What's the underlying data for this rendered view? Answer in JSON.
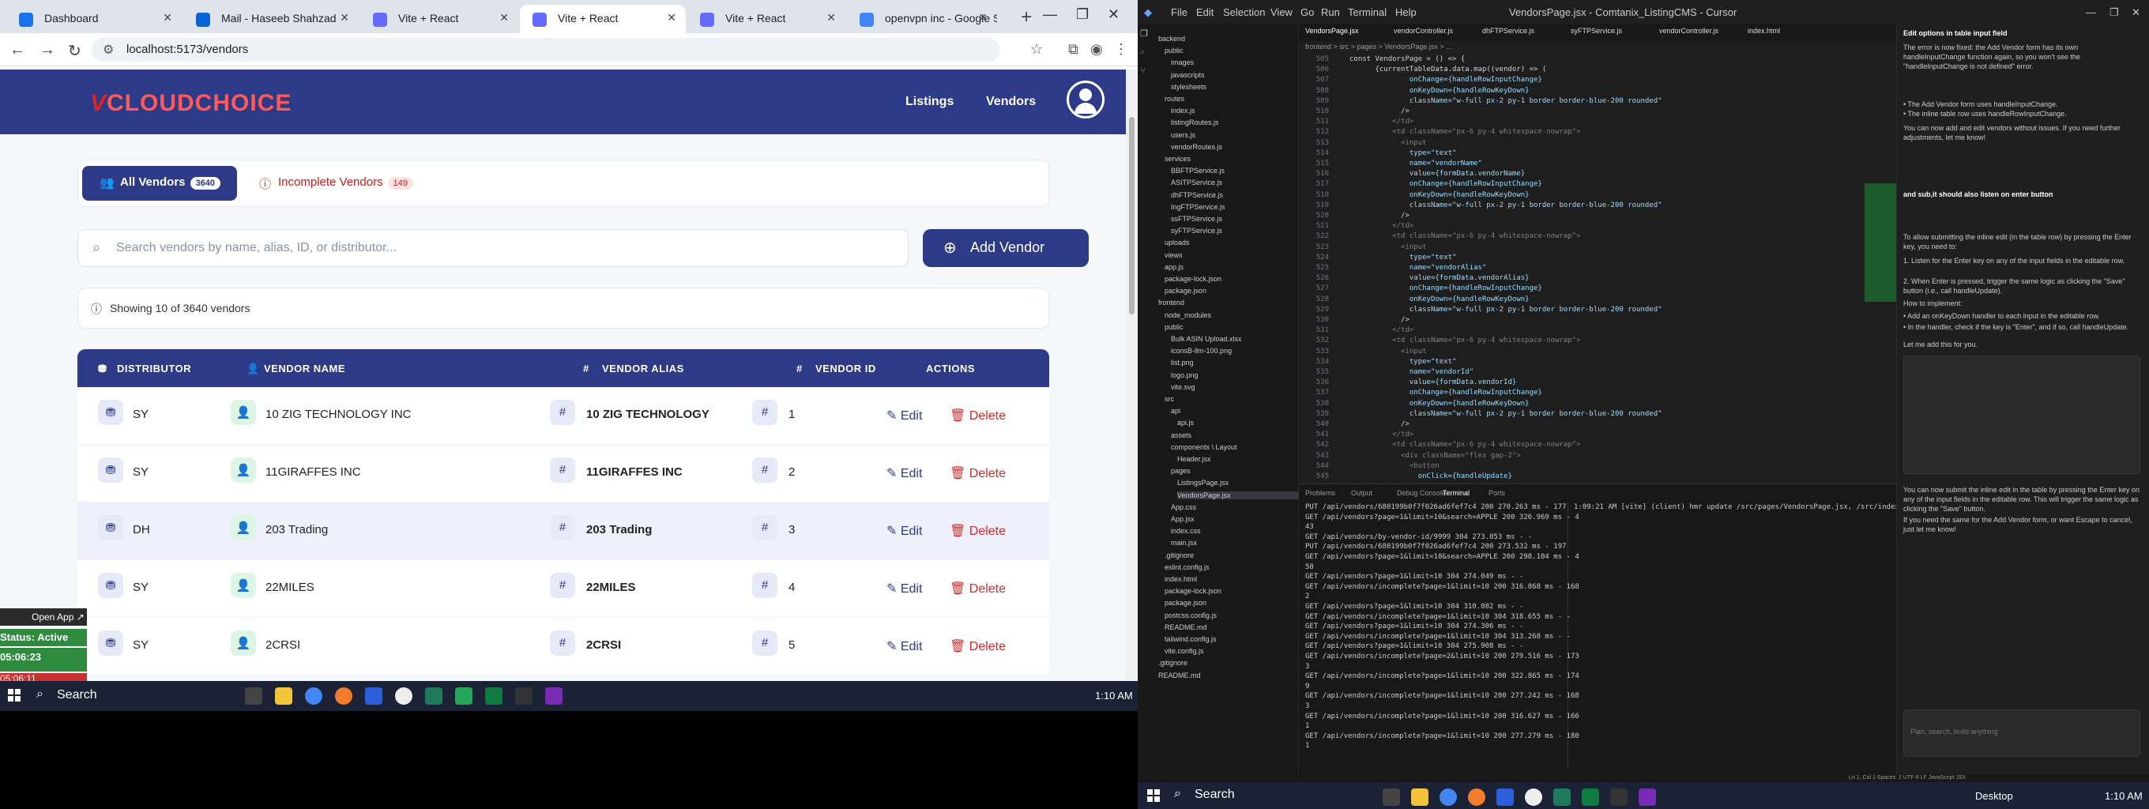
{
  "browser": {
    "tabs": [
      {
        "label": "Dashboard",
        "color": "#1a73e8"
      },
      {
        "label": "Mail - Haseeb Shahzad",
        "color": "#0a64d6"
      },
      {
        "label": "Vite + React",
        "color": "#646cff"
      },
      {
        "label": "Vite + React",
        "color": "#646cff"
      },
      {
        "label": "Vite + React",
        "color": "#646cff"
      },
      {
        "label": "openvpn inc - Google S",
        "color": "#4285f4"
      }
    ],
    "url": "localhost:5173/vendors"
  },
  "app": {
    "logo_v": "V",
    "logo_text": "CLOUDCHOICE",
    "nav": [
      "Listings",
      "Vendors"
    ],
    "filters": {
      "all_label": "All Vendors",
      "all_count": "3640",
      "incomplete_label": "Incomplete Vendors",
      "incomplete_count": "149"
    },
    "search_placeholder": "Search vendors by name, alias, ID, or distributor...",
    "add_vendor": "Add Vendor",
    "showing": "Showing 10 of 3640 vendors",
    "columns": [
      "DISTRIBUTOR",
      "VENDOR NAME",
      "VENDOR ALIAS",
      "VENDOR ID",
      "ACTIONS"
    ],
    "edit_label": "Edit",
    "delete_label": "Delete",
    "rows": [
      {
        "distributor": "SY",
        "name": "10 ZIG TECHNOLOGY INC",
        "alias": "10 ZIG TECHNOLOGY",
        "id": "1"
      },
      {
        "distributor": "SY",
        "name": "11GIRAFFES INC",
        "alias": "11GIRAFFES INC",
        "id": "2"
      },
      {
        "distributor": "DH",
        "name": "203 Trading",
        "alias": "203 Trading",
        "id": "3"
      },
      {
        "distributor": "SY",
        "name": "22MILES",
        "alias": "22MILES",
        "id": "4"
      },
      {
        "distributor": "SY",
        "name": "2CRSI",
        "alias": "2CRSI",
        "id": "5"
      }
    ]
  },
  "widget": {
    "open_app": "Open App ↗",
    "status": "Status: Active",
    "time": "05:06:23",
    "time2": "05:06:11"
  },
  "taskbar": {
    "search": "Search",
    "clock": "1:10 AM"
  },
  "vscode": {
    "menu": [
      "File",
      "Edit",
      "Selection",
      "View",
      "Go",
      "Run",
      "Terminal",
      "Help"
    ],
    "title": "VendorsPage.jsx - Comtanix_ListingCMS - Cursor",
    "explorer": [
      "backend",
      "public",
      "images",
      "javascripts",
      "stylesheets",
      "routes",
      "index.js",
      "listingRoutes.js",
      "users.js",
      "vendorRoutes.js",
      "services",
      "BBFTPService.js",
      "ASITPService.js",
      "dhFTPService.js",
      "IngFTPService.js",
      "ssFTPService.js",
      "syFTPService.js",
      "uploads",
      "views",
      "app.js",
      "package-lock.json",
      "package.json",
      "frontend",
      "node_modules",
      "public",
      "Bulk ASIN Upload.xlsx",
      "iconsB-llm-100.png",
      "list.png",
      "logo.png",
      "vite.svg",
      "src",
      "api",
      "api.js",
      "assets",
      "components \\ Layout",
      "Header.jsx",
      "pages",
      "ListingsPage.jsx",
      "VendorsPage.jsx",
      "App.css",
      "App.jsx",
      "index.css",
      "main.jsx",
      ".gitignore",
      "eslint.config.js",
      "index.html",
      "package-lock.json",
      "package.json",
      "postcss.config.js",
      "README.md",
      "tailwind.config.js",
      "vite.config.js",
      ".gitignore",
      "README.md"
    ],
    "editor_tabs": [
      "VendorsPage.jsx",
      "vendorController.js",
      "dhFTPService.js",
      "syFTPService.js",
      "vendorController.js",
      "index.html"
    ],
    "breadcrumb": "frontend > src > pages > VendorsPage.jsx > ...",
    "code_lines": [
      {
        "n": "505",
        "t": "const VendorsPage = () => {"
      },
      {
        "n": "506",
        "t": "      {currentTableData.data.map((vendor) => ("
      },
      {
        "n": "507",
        "t": "              onChange={handleRowInputChange}"
      },
      {
        "n": "508",
        "t": "              onKeyDown={handleRowKeyDown}"
      },
      {
        "n": "509",
        "t": "              className=\"w-full px-2 py-1 border border-blue-200 rounded\""
      },
      {
        "n": "510",
        "t": "            />"
      },
      {
        "n": "511",
        "t": "          </td>"
      },
      {
        "n": "512",
        "t": "          <td className=\"px-6 py-4 whitespace-nowrap\">"
      },
      {
        "n": "513",
        "t": "            <input"
      },
      {
        "n": "514",
        "t": "              type=\"text\""
      },
      {
        "n": "515",
        "t": "              name=\"vendorName\""
      },
      {
        "n": "516",
        "t": "              value={formData.vendorName}"
      },
      {
        "n": "517",
        "t": "              onChange={handleRowInputChange}"
      },
      {
        "n": "518",
        "t": "              onKeyDown={handleRowKeyDown}"
      },
      {
        "n": "519",
        "t": "              className=\"w-full px-2 py-1 border border-blue-200 rounded\""
      },
      {
        "n": "520",
        "t": "            />"
      },
      {
        "n": "521",
        "t": "          </td>"
      },
      {
        "n": "522",
        "t": "          <td className=\"px-6 py-4 whitespace-nowrap\">"
      },
      {
        "n": "523",
        "t": "            <input"
      },
      {
        "n": "524",
        "t": "              type=\"text\""
      },
      {
        "n": "525",
        "t": "              name=\"vendorAlias\""
      },
      {
        "n": "526",
        "t": "              value={formData.vendorAlias}"
      },
      {
        "n": "527",
        "t": "              onChange={handleRowInputChange}"
      },
      {
        "n": "528",
        "t": "              onKeyDown={handleRowKeyDown}"
      },
      {
        "n": "529",
        "t": "              className=\"w-full px-2 py-1 border border-blue-200 rounded\""
      },
      {
        "n": "530",
        "t": "            />"
      },
      {
        "n": "531",
        "t": "          </td>"
      },
      {
        "n": "532",
        "t": "          <td className=\"px-6 py-4 whitespace-nowrap\">"
      },
      {
        "n": "533",
        "t": "            <input"
      },
      {
        "n": "534",
        "t": "              type=\"text\""
      },
      {
        "n": "535",
        "t": "              name=\"vendorId\""
      },
      {
        "n": "536",
        "t": "              value={formData.vendorId}"
      },
      {
        "n": "537",
        "t": "              onChange={handleRowInputChange}"
      },
      {
        "n": "538",
        "t": "              onKeyDown={handleRowKeyDown}"
      },
      {
        "n": "539",
        "t": "              className=\"w-full px-2 py-1 border border-blue-200 rounded\""
      },
      {
        "n": "540",
        "t": "            />"
      },
      {
        "n": "541",
        "t": "          </td>"
      },
      {
        "n": "542",
        "t": "          <td className=\"px-6 py-4 whitespace-nowrap\">"
      },
      {
        "n": "543",
        "t": "            <div className=\"flex gap-2\">"
      },
      {
        "n": "544",
        "t": "              <button"
      },
      {
        "n": "545",
        "t": "                onClick={handleUpdate}"
      }
    ],
    "panel_tabs": [
      "Problems",
      "Output",
      "Debug Console",
      "Terminal",
      "Ports"
    ],
    "terminal_lines": [
      "PUT /api/vendors/680199b0f7f026ad6fef7c4 200 270.263 ms - 177",
      "GET /api/vendors?page=1&limit=10&search=APPLE 200 326.969 ms - 4",
      "43",
      "GET /api/vendors/by-vendor-id/9999 304 273.853 ms - -",
      "PUT /api/vendors/680199b0f7f026ad6fef7c4 200 273.532 ms - 197",
      "GET /api/vendors?page=1&limit=10&search=APPLE 200 298.104 ms - 4",
      "58",
      "GET /api/vendors?page=1&limit=10 304 274.049 ms - -",
      "GET /api/vendors/incomplete?page=1&limit=10 200 316.868 ms - 168",
      "2",
      "GET /api/vendors?page=1&limit=10 304 310.082 ms - -",
      "GET /api/vendors/incomplete?page=1&limit=10 304 318.655 ms - -",
      "GET /api/vendors?page=1&limit=10 304 274.306 ms - -",
      "GET /api/vendors/incomplete?page=1&limit=10 304 313.268 ms - -",
      "GET /api/vendors?page=1&limit=10 304 275.908 ms - -",
      "GET /api/vendors/incomplete?page=2&limit=10 200 279.516 ms - 173",
      "3",
      "GET /api/vendors/incomplete?page=1&limit=10 200 322.865 ms - 174",
      "9",
      "GET /api/vendors/incomplete?page=1&limit=10 200 277.242 ms - 168",
      "3",
      "GET /api/vendors/incomplete?page=1&limit=10 200 316.627 ms - 166",
      "1",
      "GET /api/vendors/incomplete?page=1&limit=10 200 277.279 ms - 180",
      "1"
    ],
    "terminal2": "1:09:21 AM [vite] (client) hmr update /src/pages/VendorsPage.jsx, /src/index.css (x8)",
    "chat_title": "Edit options in table input field",
    "chat_paragraphs": [
      "The error is now fixed: the Add Vendor form has its own handleInputChange function again, so you won't see the \"handleInputChange is not defined\" error.",
      "• The Add Vendor form uses handleInputChange.",
      "• The inline table row uses handleRowInputChange.",
      "You can now add and edit vendors without issues. If you need further adjustments, let me know!",
      "and sub,it should also listen on enter button",
      "To allow submitting the inline edit (in the table row) by pressing the Enter key, you need to:",
      "1. Listen for the Enter key on any of the input fields in the editable row.",
      "2. When Enter is pressed, trigger the same logic as clicking the \"Save\" button (i.e., call handleUpdate).",
      "How to implement:",
      "• Add an onKeyDown handler to each input in the editable row.",
      "• In the handler, check if the key is \"Enter\", and if so, call handleUpdate.",
      "Let me add this for you.",
      "You can now submit the inline edit in the table by pressing the Enter key on any of the input fields in the editable row. This will trigger the same logic as clicking the \"Save\" button.",
      "If you need the same for the Add Vendor form, or want Escape to cancel, just let me know!"
    ],
    "chat_input_placeholder": "Plan, search, build anything",
    "statusbar": "Ln 1, Col 1   Spaces: 2   UTF-8   LF   JavaScript JSX",
    "taskbar_search": "Search",
    "taskbar_desktop": "Desktop",
    "taskbar_clock": "1:10 AM"
  }
}
